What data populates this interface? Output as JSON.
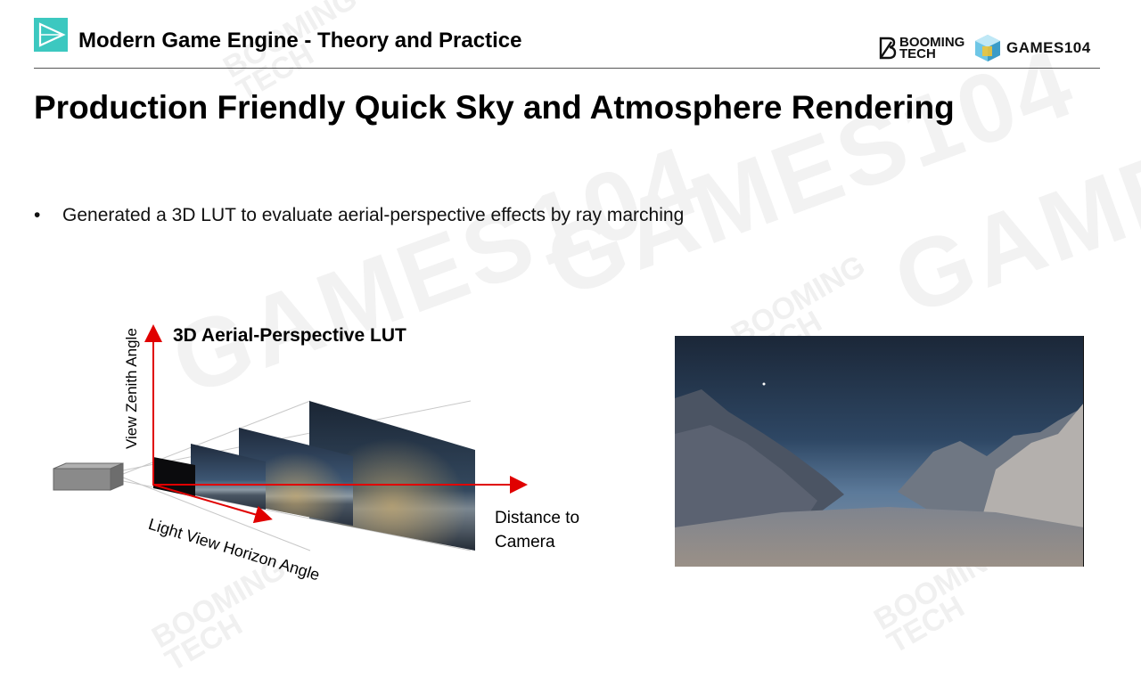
{
  "header": {
    "course_title": "Modern Game Engine - Theory and Practice",
    "brand_booming_line1": "BOOMING",
    "brand_booming_line2": "TECH",
    "brand_games": "GAMES104"
  },
  "slide": {
    "title": "Production Friendly Quick Sky and Atmosphere Rendering",
    "bullets": [
      "Generated a 3D LUT to evaluate aerial-perspective effects by ray marching"
    ]
  },
  "diagram": {
    "title": "3D Aerial-Perspective LUT",
    "y_axis_label": "View Zenith Angle",
    "x_axis_label": "Light View Horizon Angle",
    "z_axis_label_line1": "Distance to",
    "z_axis_label_line2": "Camera"
  },
  "watermark": {
    "large": "GAMES104",
    "small_line1": "BOOMING",
    "small_line2": "TECH"
  },
  "colors": {
    "logo": "#3cc8c0",
    "arrow": "#e00000",
    "camera": "#8a8a8a"
  }
}
